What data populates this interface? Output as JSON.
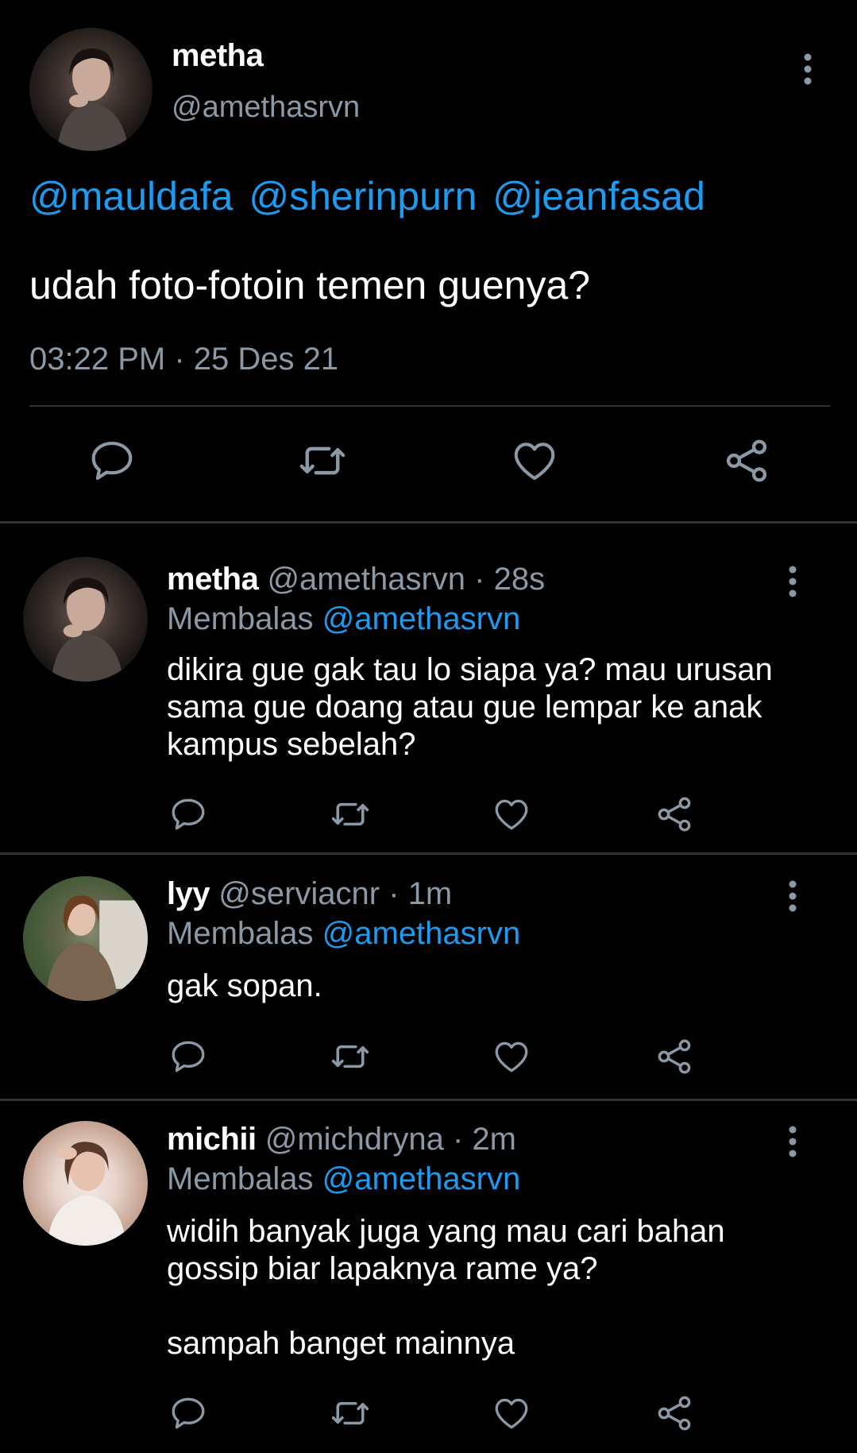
{
  "main_tweet": {
    "name": "metha",
    "handle": "@amethasrvn",
    "mentions": [
      "@mauldafa",
      "@sherinpurn",
      "@jeanfasad"
    ],
    "text": "udah foto-fotoin temen guenya?",
    "timestamp": "03:22 PM · 25 Des 21",
    "actions": [
      "reply-icon",
      "retweet-icon",
      "like-icon",
      "share-icon"
    ]
  },
  "replies": [
    {
      "name": "metha",
      "handle": "@amethasrvn",
      "dot": "·",
      "time": "28s",
      "replying_label": "Membalas",
      "replying_to": "@amethasrvn",
      "text": "dikira gue gak tau lo siapa ya? mau urusan sama gue doang atau gue lempar ke anak kampus sebelah?"
    },
    {
      "name": "lyy",
      "handle": "@serviacnr",
      "dot": "·",
      "time": "1m",
      "replying_label": "Membalas",
      "replying_to": "@amethasrvn",
      "text": "gak sopan."
    },
    {
      "name": "michii",
      "handle": "@michdryna",
      "dot": "·",
      "time": "2m",
      "replying_label": "Membalas",
      "replying_to": "@amethasrvn",
      "text": "widih banyak juga yang mau cari bahan gossip biar lapaknya rame ya?\n\nsampah banget mainnya"
    }
  ],
  "colors": {
    "background": "#000000",
    "text": "#ffffff",
    "muted": "#8b98a5",
    "accent": "#1d9bf0",
    "divider": "#2f3336"
  }
}
